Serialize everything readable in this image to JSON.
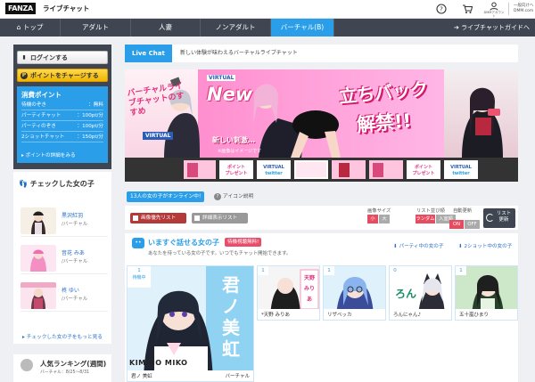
{
  "header": {
    "logo": "FANZA",
    "service": "ライブチャット",
    "user_label": "DMMアカウント",
    "corp": [
      "一般向けへ",
      "DMM.com"
    ]
  },
  "nav": {
    "items": [
      "トップ",
      "アダルト",
      "人妻",
      "ノンアダルト",
      "バーチャル(B)"
    ],
    "active": "バーチャル(B)",
    "guide": "ライブチャットガイドへ"
  },
  "sidebar": {
    "login": "ログインする",
    "charge": "ポイントをチャージする",
    "points": {
      "title": "消費ポイント",
      "rows": [
        {
          "label": "待機のぞき",
          "value": "：無料"
        },
        {
          "label": "パーティチャット",
          "value": "：100pt/分"
        },
        {
          "label": "パーティのぞき",
          "value": "：100pt/分"
        },
        {
          "label": "2ショットチャット",
          "value": "：150pt/分"
        }
      ],
      "link": "ポイントの詳細をみる"
    },
    "checked": {
      "title": "チェックした女の子",
      "items": [
        {
          "name": "黒沢紅羽",
          "cat": "/バーチャル"
        },
        {
          "name": "音花 みあ",
          "cat": "/バーチャル"
        },
        {
          "name": "柊 ゆい",
          "cat": "/バーチャル"
        }
      ],
      "more": "チェックした女の子をもっと見る"
    },
    "ranking": {
      "title": "人気ランキング(週間)",
      "sub": "バーチャル：8/25〜8/31"
    }
  },
  "main": {
    "live_badge": "Live Chat",
    "live_sub": "新しい体験が味わえるバーチャルライブチャット",
    "banner": {
      "left_title": "バーチャルライブチャットのすすめ",
      "virtual": "VIRTUAL",
      "new": "New",
      "headline_1": "立ちバック",
      "headline_2": "解禁!!",
      "note": "新しい刺激…",
      "note2": "※画像はイメージです"
    },
    "strip": [
      "VIRTUAL twitter",
      "ポイントプレゼント"
    ],
    "online": "13人の女の子がオンライン中!",
    "icon_help": "アイコン説明",
    "tabs": {
      "fav": "画像優先リスト",
      "detail": "詳細表示リスト"
    },
    "controls": {
      "size_label": "画像サイズ",
      "size_opts": [
        "小",
        "大"
      ],
      "order_label": "リスト並び順",
      "order_opts": [
        "ランダム",
        "入室順"
      ],
      "auto_label": "自動更新",
      "auto_opts": [
        "ON",
        "OFF"
      ],
      "refresh": [
        "リスト",
        "更新"
      ]
    },
    "section": {
      "icon": "••",
      "title": "いますぐ話せる女の子",
      "badge": "待機視聴無料!",
      "sub": "あなたを待っている女の子です。いつでもチャット開始できます。",
      "link_party": "パーティ中の女の子",
      "link_2shot": "2ショット中の女の子"
    },
    "cards": [
      {
        "count": "1",
        "status": "待機中",
        "name": "君ノ 美虹",
        "cat": "バーチャル",
        "title_text": "君ノ美虹",
        "brand": "KIMINO MIKO"
      },
      {
        "count": "1",
        "status": "",
        "name": "*天野 みりあ",
        "cat": "",
        "brand": "天野みりあ"
      },
      {
        "count": "1",
        "status": "",
        "name": "リザベッカ",
        "cat": "",
        "brand": ""
      },
      {
        "count": "0",
        "status": "",
        "name": "ろんにゃん♪",
        "cat": "",
        "brand": "ろん"
      },
      {
        "count": "1",
        "status": "",
        "name": "五十嵐ひまり",
        "cat": "",
        "brand": ""
      }
    ]
  }
}
